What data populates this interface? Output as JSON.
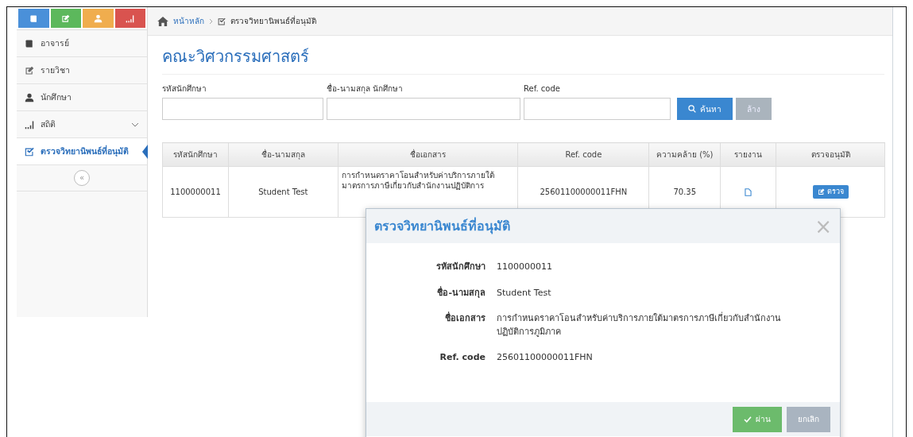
{
  "sidebar": {
    "top_buttons": [
      {
        "color": "#4a90d9"
      },
      {
        "color": "#5cb85c"
      },
      {
        "color": "#f0ad4e"
      },
      {
        "color": "#d9534f"
      }
    ],
    "items": [
      {
        "label": "อาจารย์",
        "kind": "link",
        "selected": false
      },
      {
        "label": "รายวิชา",
        "kind": "link",
        "selected": false
      },
      {
        "label": "นักศึกษา",
        "kind": "link",
        "selected": false
      },
      {
        "label": "สถิติ",
        "kind": "submenu",
        "selected": false
      },
      {
        "label": "ตรวจวิทยานิพนธ์ที่อนุมัติ",
        "kind": "link",
        "selected": true
      }
    ],
    "collapse_button": "«"
  },
  "breadcrumb": [
    {
      "label": "หน้าหลัก",
      "kind": "home"
    },
    {
      "label": "ตรวจวิทยานิพนธ์ที่อนุมัติ",
      "kind": "current"
    }
  ],
  "title": "คณะวิศวกรรมศาสตร์",
  "search": {
    "fields": [
      {
        "label": "รหัสนักศึกษา"
      },
      {
        "label": "ชื่อ-นามสกุล นักศึกษา"
      },
      {
        "label": "Ref. code"
      }
    ],
    "search_button": "ค้นหา",
    "clear_button": "ล้าง"
  },
  "table": {
    "columns": [
      "รหัสนักศึกษา",
      "ชื่อ-นามสกุล",
      "ชื่อเอกสาร",
      "Ref. code",
      "ความคล้าย (%)",
      "รายงาน",
      "ตรวจอนุมัติ"
    ],
    "rows": [
      {
        "cells": [
          "1100000011",
          "Student Test",
          "การกำหนดราคาโอนสำหรับค่าบริการภายใต้มาตรการภาษีเกี่ยวกับสำนักงานปฏิบัติการ",
          "25601100000011FHN",
          "70.35"
        ],
        "action_button": "ตรวจ"
      }
    ]
  },
  "modal": {
    "title": "ตรวจวิทยานิพนธ์ที่อนุมัติ",
    "close": "×",
    "fields": [
      {
        "label": "รหัสนักศึกษา",
        "value": "1100000011"
      },
      {
        "label": "ชื่อ-นามสกุล",
        "value": "Student Test"
      },
      {
        "label": "ชื่อเอกสาร",
        "value": "การกำหนดราคาโอนสำหรับค่าบริการภายใต้มาตรการภาษีเกี่ยวกับสำนักงานปฏิบัติการภูมิภาค"
      },
      {
        "label": "Ref. code",
        "value": "25601100000011FHN"
      }
    ],
    "approve_button": "ผ่าน",
    "cancel_button": "ยกเลิก"
  }
}
